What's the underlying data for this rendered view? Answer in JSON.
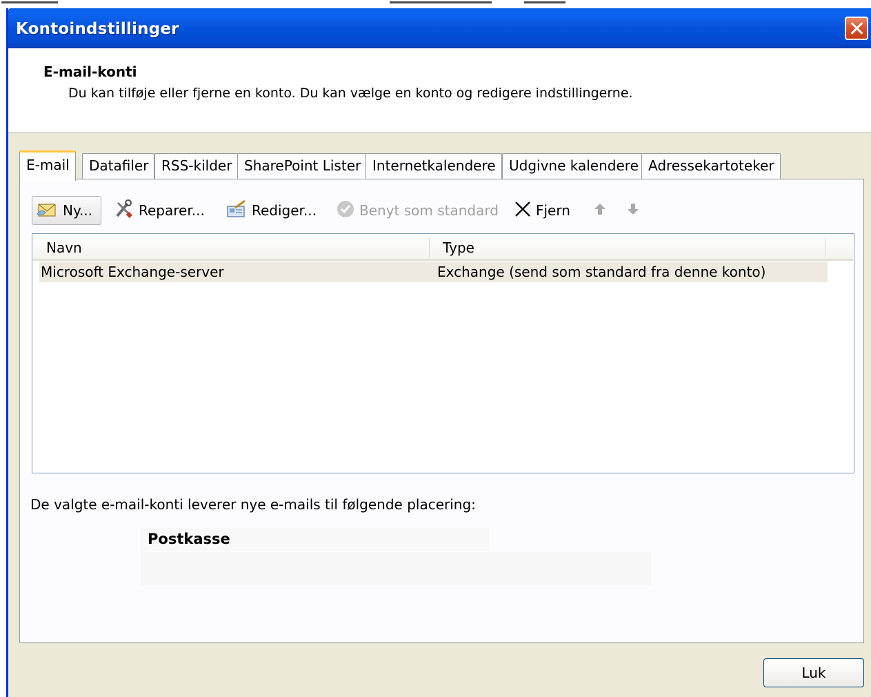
{
  "window": {
    "title": "Kontoindstillinger"
  },
  "header": {
    "title": "E-mail-konti",
    "description": "Du kan tilføje eller fjerne en konto. Du kan vælge en konto og redigere indstillingerne."
  },
  "tabs": [
    {
      "label": "E-mail",
      "active": true
    },
    {
      "label": "Datafiler"
    },
    {
      "label": "RSS-kilder"
    },
    {
      "label": "SharePoint Lister"
    },
    {
      "label": "Internetkalendere"
    },
    {
      "label": "Udgivne kalendere"
    },
    {
      "label": "Adressekartoteker"
    }
  ],
  "toolbar": {
    "new_label": "Ny...",
    "repair_label": "Reparer...",
    "edit_label": "Rediger...",
    "default_label": "Benyt som standard",
    "remove_label": "Fjern"
  },
  "accounts_table": {
    "columns": [
      "Navn",
      "Type"
    ],
    "rows": [
      {
        "name": "Microsoft Exchange-server",
        "type": "Exchange (send som standard fra denne konto)"
      }
    ]
  },
  "delivery": {
    "text": "De valgte e-mail-konti leverer nye e-mails til følgende placering:",
    "mailbox_label": "Postkasse"
  },
  "footer": {
    "close_label": "Luk"
  },
  "colors": {
    "titlebar": "#0553dc",
    "dialog_bg": "#ece9d8",
    "active_tab_accent": "#ffc83c",
    "close_button": "#d9532e"
  }
}
